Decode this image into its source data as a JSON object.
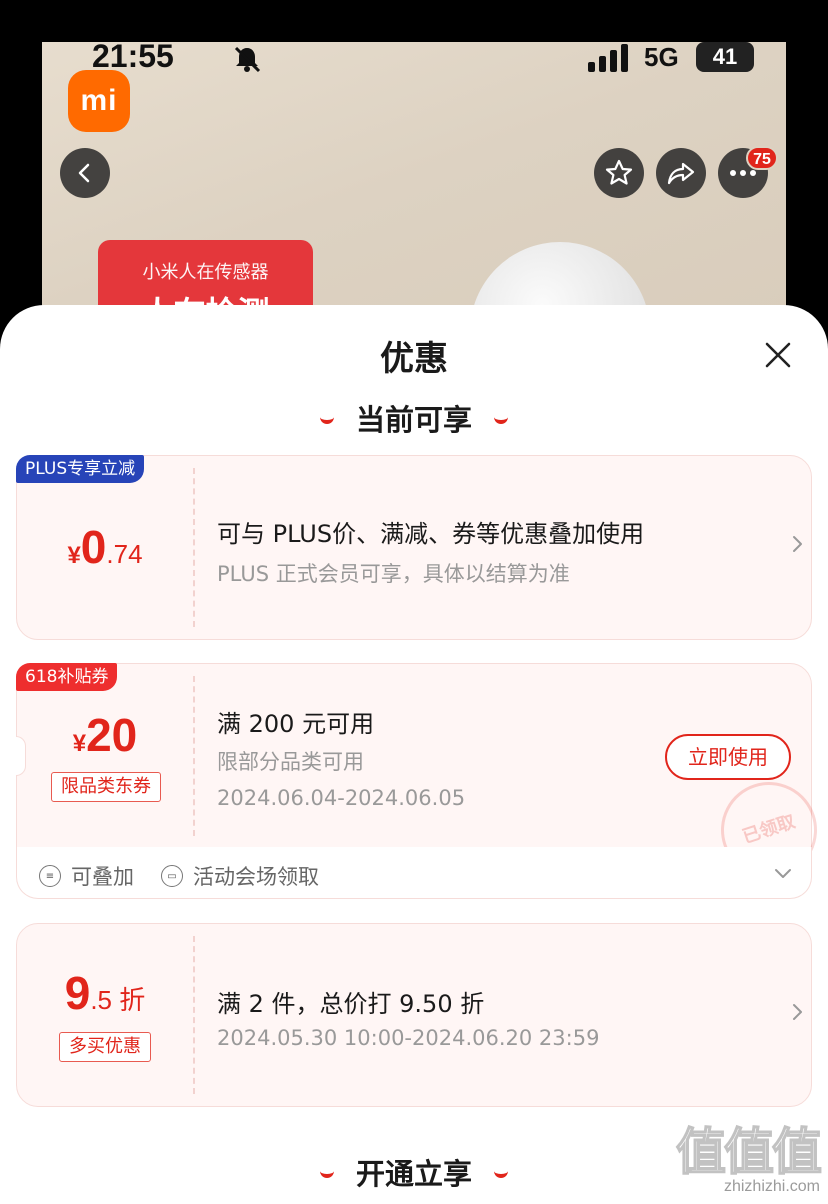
{
  "status_bar": {
    "time": "21:55",
    "network": "5G",
    "battery": "41"
  },
  "product_page": {
    "brand_logo_text": "mi",
    "more_badge_count": "75",
    "promo_card_title": "小米人在传感器",
    "promo_card_big_text": "人在检测"
  },
  "sheet": {
    "title": "优惠",
    "section_current": "当前可享",
    "section_open": "开通立享"
  },
  "coupons": [
    {
      "tag": "PLUS专享立减",
      "currency": "¥",
      "amount_main": "0",
      "amount_fraction": ".74",
      "title": "可与 PLUS价、满减、券等优惠叠加使用",
      "subtitle": "PLUS 正式会员可享，具体以结算为准"
    },
    {
      "tag": "618补贴券",
      "currency": "¥",
      "amount_main": "20",
      "label": "限品类东券",
      "title": "满 200 元可用",
      "subtitle": "限部分品类可用",
      "date_range": "2024.06.04-2024.06.05",
      "button": "立即使用",
      "stamp": "已领取",
      "footer_stackable": "可叠加",
      "footer_source": "活动会场领取"
    },
    {
      "amount_main": "9",
      "amount_fraction": ".5 折",
      "label": "多买优惠",
      "title": "满 2 件，总价打 9.50 折",
      "date_range": "2024.05.30 10:00-2024.06.20 23:59"
    }
  ],
  "watermark": {
    "logo": "值值值",
    "url": "zhizhizhi.com"
  },
  "colors": {
    "accent_red": "#e1251b",
    "plus_blue": "#2744b8",
    "coupon_bg": "#fff6f5"
  }
}
